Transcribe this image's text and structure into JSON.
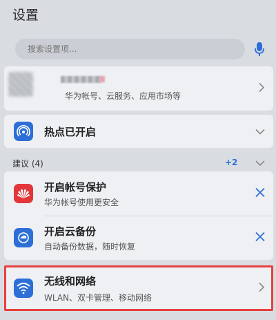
{
  "header": {
    "title": "设置"
  },
  "search": {
    "placeholder": "搜索设置项..."
  },
  "account": {
    "subtitle": "华为帐号、云服务、应用市场等"
  },
  "hotspot": {
    "title": "热点已开启"
  },
  "suggestions": {
    "label": "建议 (4)",
    "more": "+2",
    "items": [
      {
        "title": "开启帐号保护",
        "subtitle": "华为帐号使用更安全"
      },
      {
        "title": "开启云备份",
        "subtitle": "自动备份数据，随时恢复"
      }
    ]
  },
  "wireless": {
    "title": "无线和网络",
    "subtitle": "WLAN、双卡管理、移动网络"
  },
  "colors": {
    "accent": "#2d6fd6",
    "huawei_red": "#e2363a",
    "highlight_red": "#e8403d"
  }
}
